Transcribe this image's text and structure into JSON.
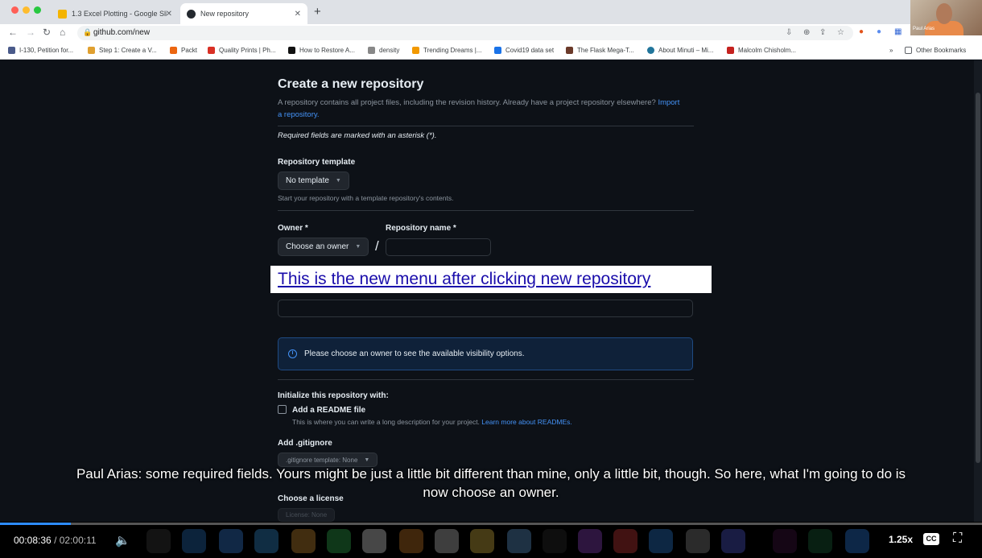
{
  "browser": {
    "tabs": [
      {
        "label": "1.3 Excel Plotting - Google Slid",
        "icon": "google-slides-icon"
      },
      {
        "label": "New repository",
        "icon": "github-icon"
      }
    ],
    "url": "github.com/new",
    "bookmarks": [
      "I-130, Petition for...",
      "Step 1: Create a V...",
      "Packt",
      "Quality Prints | Ph...",
      "How to Restore A...",
      "density",
      "Trending Dreams |...",
      "Covid19 data set",
      "The Flask Mega-T...",
      "About Minuti – Mi...",
      "Malcolm Chisholm..."
    ],
    "other_bookmarks": "Other Bookmarks",
    "more_bookmarks": "»"
  },
  "webcam": {
    "name": "Paul Arias"
  },
  "page": {
    "title": "Create a new repository",
    "description": "A repository contains all project files, including the revision history. Already have a project repository elsewhere?",
    "import_link": "Import a repository.",
    "required_note": "Required fields are marked with an asterisk (*).",
    "template_label": "Repository template",
    "template_value": "No template",
    "template_hint": "Start your repository with a template repository's contents.",
    "owner_label": "Owner *",
    "owner_value": "Choose an owner",
    "repo_name_label": "Repository name *",
    "slash": "/",
    "overlay_banner": "This is the new menu after clicking new repository",
    "visibility_info": "Please choose an owner to see the available visibility options.",
    "initialize_label": "Initialize this repository with:",
    "readme_label": "Add a README file",
    "readme_hint": "This is where you can write a long description for your project.",
    "readme_link": "Learn more about READMEs.",
    "gitignore_label": "Add .gitignore",
    "gitignore_value": ".gitignore template: None",
    "license_label": "Choose a license",
    "license_value": "License: None"
  },
  "caption": {
    "line1": "Paul Arias: some required fields. Yours might be just a little bit different than mine, only a little bit, though. So here, what I'm going to do is",
    "line2": "now choose an owner."
  },
  "player": {
    "elapsed": "00:08:36",
    "separator": "/",
    "duration": "02:00:11",
    "progress_fraction": 0.072,
    "speed": "1.25x",
    "cc": "CC"
  }
}
